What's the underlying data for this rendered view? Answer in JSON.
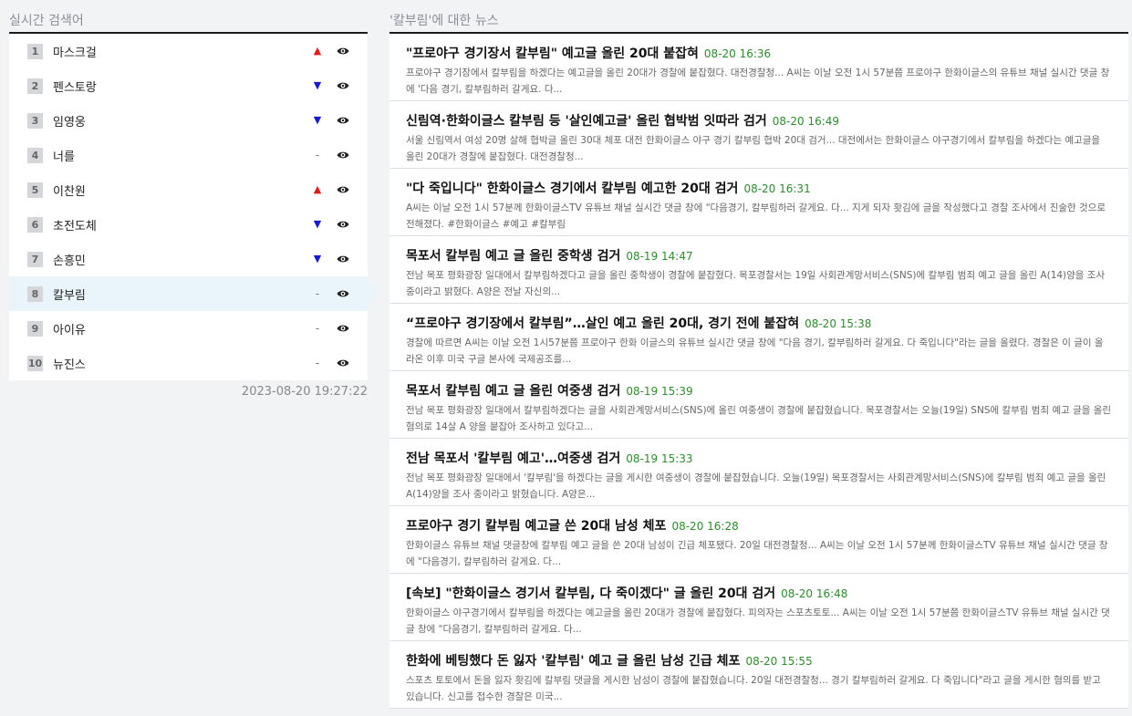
{
  "realtime": {
    "title": "실시간 검색어",
    "items": [
      {
        "rank": "1",
        "word": "마스크걸",
        "trend": "up",
        "trend_symbol": "▲"
      },
      {
        "rank": "2",
        "word": "펜스토랑",
        "trend": "down",
        "trend_symbol": "▼"
      },
      {
        "rank": "3",
        "word": "임영웅",
        "trend": "down",
        "trend_symbol": "▼"
      },
      {
        "rank": "4",
        "word": "너를",
        "trend": "same",
        "trend_symbol": "-"
      },
      {
        "rank": "5",
        "word": "이찬원",
        "trend": "up",
        "trend_symbol": "▲"
      },
      {
        "rank": "6",
        "word": "초전도체",
        "trend": "down",
        "trend_symbol": "▼"
      },
      {
        "rank": "7",
        "word": "손흥민",
        "trend": "down",
        "trend_symbol": "▼"
      },
      {
        "rank": "8",
        "word": "칼부림",
        "trend": "same",
        "trend_symbol": "-"
      },
      {
        "rank": "9",
        "word": "아이유",
        "trend": "same",
        "trend_symbol": "-"
      },
      {
        "rank": "10",
        "word": "뉴진스",
        "trend": "same",
        "trend_symbol": "-"
      }
    ],
    "selected_rank": "8",
    "updated_at": "2023-08-20 19:27:22"
  },
  "news": {
    "title": "'칼부림'에 대한 뉴스",
    "items": [
      {
        "title": "\"프로야구 경기장서 칼부림\" 예고글 올린 20대 붙잡혀",
        "time": "08-20 16:36",
        "summary": "프로야구 경기장에서 칼부림을 하겠다는 예고글을 올린 20대가 경찰에 붙잡혔다. 대전경찰청... A씨는 이날 오전 1시 57분쯤 프로야구 한화이글스의 유튜브 채널 실시간 댓글 창에 '다음 경기, 칼부림하러 갈게요. 다..."
      },
      {
        "title": "신림역·한화이글스 칼부림 등 '살인예고글' 올린 협박범 잇따라 검거",
        "time": "08-20 16:49",
        "summary": "서울 신림역서 여성 20명 살해 협박글 올린 30대 체포 대전 한화이글스 야구 경기 칼부림 협박 20대 검거... 대전에서는 한화이글스 야구경기에서 칼부림을 하겠다는 예고글을 올린 20대가 경찰에 붙잡혔다. 대전경찰청..."
      },
      {
        "title": "\"다 죽입니다\" 한화이글스 경기에서 칼부림 예고한 20대 검거",
        "time": "08-20 16:31",
        "summary": "A씨는 이날 오전 1시 57분께 한화이글스TV 유튜브 채널 실시간 댓글 창에 \"다음경기, 칼부림하러 갈게요. 다... 지게 되자 홧김에 글을 작성했다고 경찰 조사에서 진술한 것으로 전해졌다. #한화이글스 #예고 #칼부림"
      },
      {
        "title": "목포서 칼부림 예고 글 올린 중학생 검거",
        "time": "08-19 14:47",
        "summary": "전남 목포 평화광장 일대에서 칼부림하겠다고 글을 올린 중학생이 경찰에 붙잡혔다. 목포경찰서는 19일 사회관계망서비스(SNS)에 칼부림 범죄 예고 글을 올린 A(14)양을 조사 중이라고 밝혔다. A양은 전날 자신의..."
      },
      {
        "title": "“프로야구 경기장에서 칼부림”…살인 예고 올린 20대, 경기 전에 붙잡혀",
        "time": "08-20 15:38",
        "summary": "경찰에 따르면 A씨는 이날 오전 1시57분쯤 프로야구 한화 이글스의 유튜브 실시간 댓글 창에 \"다음 경기, 칼부림하러 갈게요. 다 죽입니다\"라는 글을 올렸다. 경찰은 이 글이 올라온 이후 미국 구글 본사에 국제공조를..."
      },
      {
        "title": "목포서 칼부림 예고 글 올린 여중생 검거",
        "time": "08-19 15:39",
        "summary": "전남 목포 평화광장 일대에서 칼부림하겠다는 글을 사회관계망서비스(SNS)에 올린 여중생이 경찰에 붙잡혔습니다. 목포경찰서는 오늘(19일) SNS에 칼부림 범죄 예고 글을 올린 혐의로 14살 A 양을 붙잡아 조사하고 있다고..."
      },
      {
        "title": "전남 목포서 '칼부림 예고'…여중생 검거",
        "time": "08-19 15:33",
        "summary": "전남 목포 평화광장 일대에서 '칼부림'을 하겠다는 글을 게시한 여중생이 경찰에 붙잡혔습니다. 오늘(19일) 목포경찰서는 사회관계망서비스(SNS)에 칼부림 범죄 예고 글을 올린 A(14)양을 조사 중이라고 밝혔습니다. A양은..."
      },
      {
        "title": "프로야구 경기 칼부림 예고글 쓴 20대 남성 체포",
        "time": "08-20 16:28",
        "summary": "한화이글스 유튜브 채널 댓글창에 칼부림 예고 글을 쓴 20대 남성이 긴급 체포됐다. 20일 대전경찰청... A씨는 이날 오전 1시 57분께 한화이글스TV 유튜브 채널 실시간 댓글 창에 \"다음경기, 칼부림하러 갈게요. 다..."
      },
      {
        "title": "[속보] \"한화이글스 경기서 칼부림, 다 죽이겠다\" 글 올린 20대 검거",
        "time": "08-20 16:48",
        "summary": "한화이글스 야구경기에서 칼부림을 하겠다는 예고글을 올린 20대가 경찰에 붙잡혔다. 피의자는 스포츠토토... A씨는 이날 오전 1시 57분쯤 한화이글스TV 유튜브 채널 실시간 댓글 창에 \"다음경기, 칼부림하러 갈게요. 다..."
      },
      {
        "title": "한화에 베팅했다 돈 잃자 '칼부림' 예고 글 올린 남성 긴급 체포",
        "time": "08-20 15:55",
        "summary": "스포츠 토토에서 돈을 잃자 홧김에 칼부림 댓글을 게시한 남성이 경찰에 붙잡혔습니다. 20일 대전경찰청... 경기 칼부림하러 갈게요. 다 죽입니다\"라고 글을 게시한 혐의를 받고 있습니다. 신고를 접수한 경찰은 미국..."
      }
    ]
  },
  "colors": {
    "trend_up": "#e21a1a",
    "trend_down": "#1a1ad6",
    "news_time": "#2e8b2e",
    "selected_row_bg": "#eaf4fb"
  },
  "icons": {
    "view": "eye-icon",
    "trend_up": "triangle-up-icon",
    "trend_down": "triangle-down-icon"
  }
}
